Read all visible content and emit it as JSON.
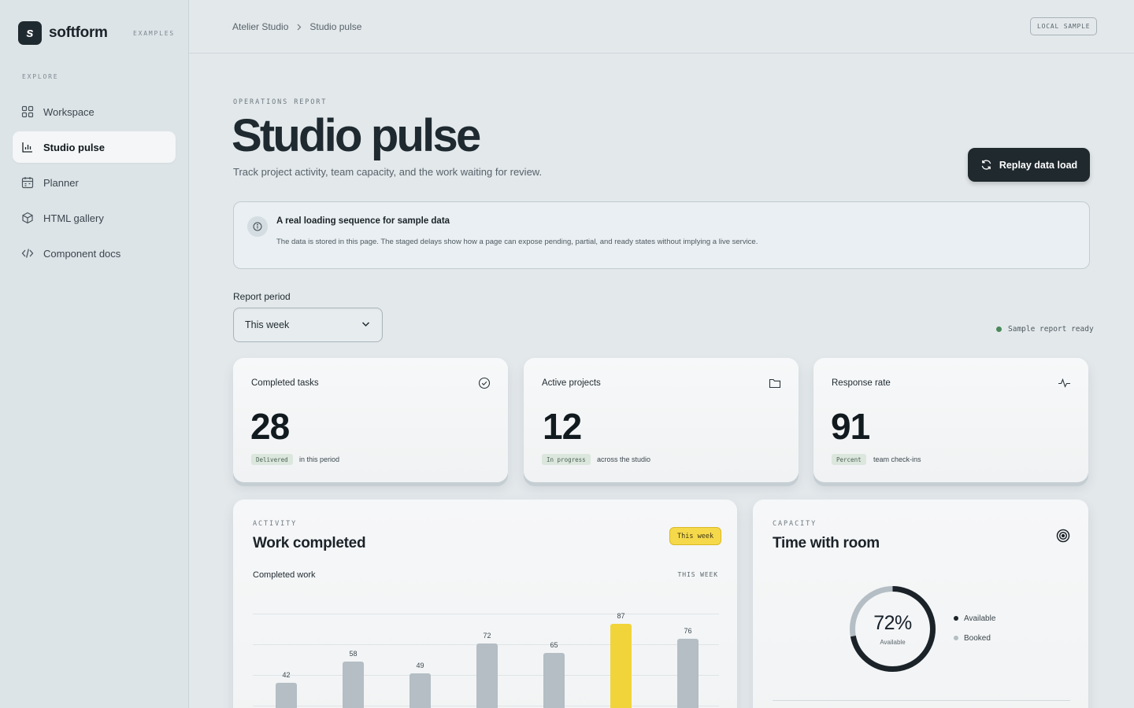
{
  "brand": {
    "logo_letter": "s",
    "name": "softform",
    "tag": "EXAMPLES"
  },
  "nav": {
    "heading": "EXPLORE",
    "items": [
      {
        "label": "Workspace",
        "icon": "grid-icon"
      },
      {
        "label": "Studio pulse",
        "icon": "bar-chart-icon",
        "active": true
      },
      {
        "label": "Planner",
        "icon": "calendar-icon"
      },
      {
        "label": "HTML gallery",
        "icon": "cube-icon"
      },
      {
        "label": "Component docs",
        "icon": "code-icon"
      }
    ]
  },
  "breadcrumb": {
    "parent": "Atelier Studio",
    "current": "Studio pulse"
  },
  "local_sample": "LOCAL SAMPLE",
  "header": {
    "eyebrow": "OPERATIONS REPORT",
    "title": "Studio pulse",
    "subtitle": "Track project activity, team capacity, and the work waiting for review.",
    "replay_label": "Replay data load"
  },
  "notice": {
    "title": "A real loading sequence for sample data",
    "body": "The data is stored in this page. The staged delays show how a page can expose pending, partial, and ready states without implying a live service."
  },
  "period": {
    "label": "Report period",
    "value": "This week"
  },
  "status_text": "Sample report ready",
  "metrics": [
    {
      "label": "Completed tasks",
      "value": "28",
      "badge": "Delivered",
      "note": "in this period",
      "icon": "check-circle-icon"
    },
    {
      "label": "Active projects",
      "value": "12",
      "badge": "In progress",
      "note": "across the studio",
      "icon": "folder-icon"
    },
    {
      "label": "Response rate",
      "value": "91",
      "badge": "Percent",
      "note": "team check-ins",
      "icon": "pulse-icon"
    }
  ],
  "activity": {
    "eyebrow": "ACTIVITY",
    "title": "Work completed",
    "pill": "This week",
    "chart_label": "Completed work",
    "chart_period": "THIS WEEK"
  },
  "chart_data": {
    "type": "bar",
    "title": "Completed work",
    "categories": [],
    "values": [
      42,
      58,
      49,
      72,
      65,
      87,
      76
    ],
    "highlight_index": 5,
    "ylim": [
      0,
      100
    ],
    "grid": true,
    "colors": {
      "bar": "#b4bec4",
      "highlight": "#f1d43a"
    }
  },
  "capacity": {
    "eyebrow": "CAPACITY",
    "title": "Time with room",
    "donut_value": "72%",
    "donut_caption": "Available",
    "percent_available": 72,
    "legend": [
      {
        "label": "Available",
        "color": "#1b2329"
      },
      {
        "label": "Booked",
        "color": "#b4bec4"
      }
    ]
  }
}
